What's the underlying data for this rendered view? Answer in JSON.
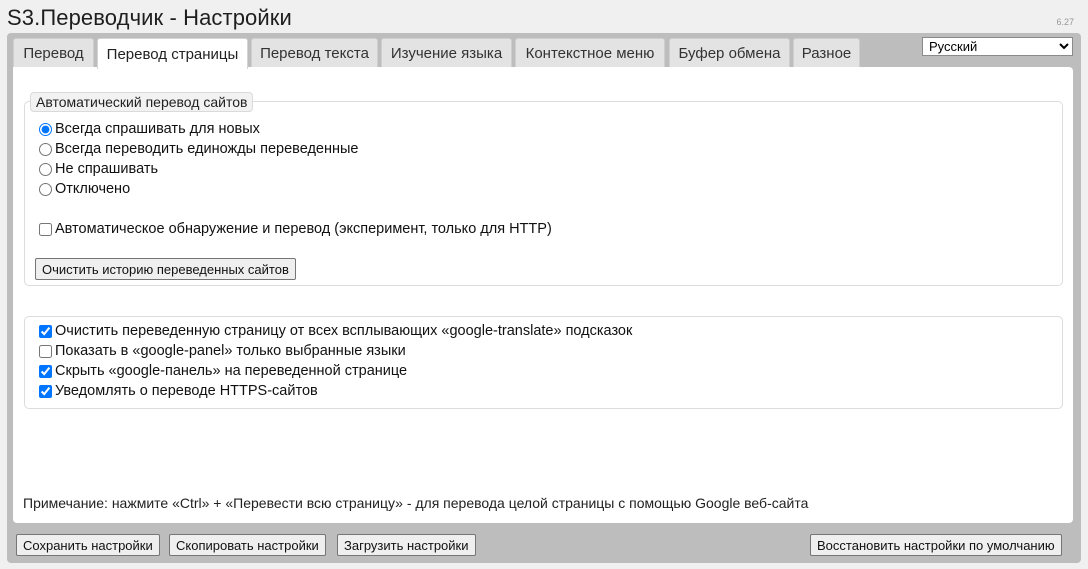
{
  "window": {
    "title": "S3.Переводчик - Настройки",
    "version": "6.27"
  },
  "tabs": [
    {
      "label": "Перевод"
    },
    {
      "label": "Перевод страницы"
    },
    {
      "label": "Перевод текста"
    },
    {
      "label": "Изучение языка"
    },
    {
      "label": "Контекстное меню"
    },
    {
      "label": "Буфер обмена"
    },
    {
      "label": "Разное"
    }
  ],
  "active_tab": "Перевод страницы",
  "language": {
    "selected": "Русский"
  },
  "auto_translate": {
    "legend": "Автоматический перевод сайтов",
    "options": [
      {
        "label": "Всегда спрашивать для новых",
        "checked": true
      },
      {
        "label": "Всегда переводить единожды переведенные",
        "checked": false
      },
      {
        "label": "Не спрашивать",
        "checked": false
      },
      {
        "label": "Отключено",
        "checked": false
      }
    ],
    "auto_detect": {
      "label": "Автоматическое обнаружение и перевод (эксперимент, только для HTTP)",
      "checked": false
    },
    "clear_history_button": "Очистить историю переведенных сайтов"
  },
  "page_options": [
    {
      "label": "Очистить переведенную страницу от всех всплывающих «google-translate» подсказок",
      "checked": true
    },
    {
      "label": "Показать в «google-panel» только выбранные языки",
      "checked": false
    },
    {
      "label": "Скрыть «google-панель» на переведенной странице",
      "checked": true
    },
    {
      "label": "Уведомлять о переводе HTTPS-сайтов",
      "checked": true
    }
  ],
  "note": "Примечание: нажмите «Ctrl» + «Перевести всю страницу» - для перевода целой страницы с помощью Google веб-сайта",
  "footer": {
    "save": "Сохранить настройки",
    "copy": "Скопировать настройки",
    "load": "Загрузить настройки",
    "restore": "Восстановить настройки по умолчанию"
  }
}
